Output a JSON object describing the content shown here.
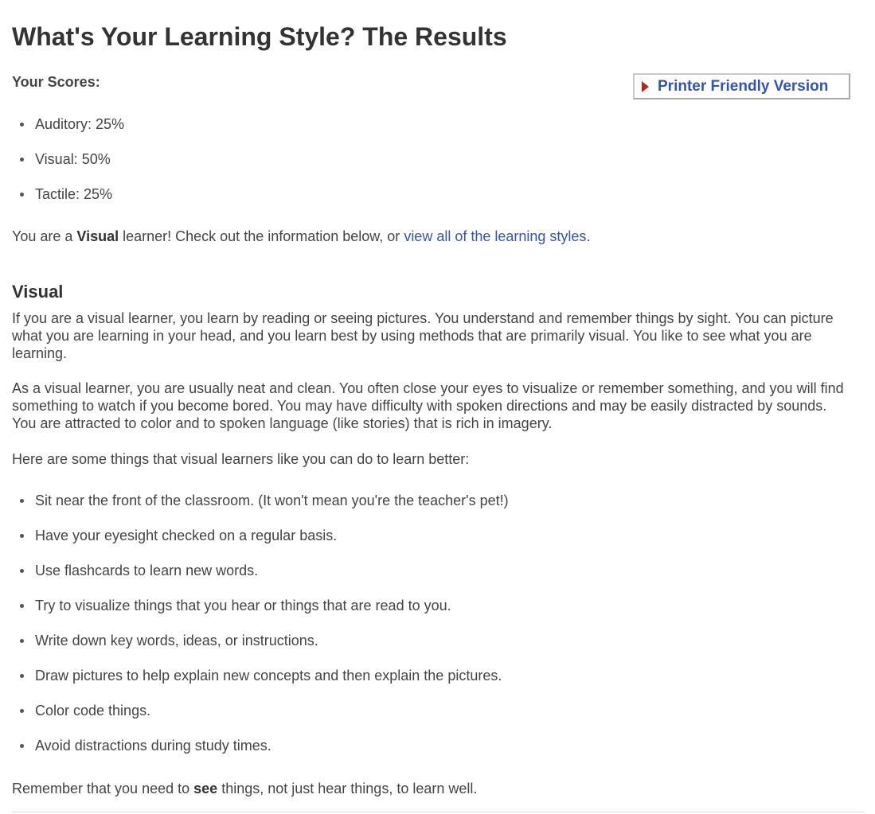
{
  "page": {
    "title": "What's Your Learning Style? The Results",
    "scores_label": "Your Scores:",
    "printer_button_label": "Printer Friendly Version",
    "scores": [
      "Auditory: 25%",
      "Visual: 50%",
      "Tactile: 25%"
    ],
    "result": {
      "prefix": "You are a ",
      "style": "Visual",
      "middle": " learner! Check out the information below, or ",
      "link_text": "view all of the learning styles",
      "suffix": "."
    }
  },
  "section": {
    "heading": "Visual",
    "paragraph1": "If you are a visual learner, you learn by reading or seeing pictures. You understand and remember things by sight. You can picture what you are learning in your head, and you learn best by using methods that are primarily visual. You like to see what you are learning.",
    "paragraph2": "As a visual learner, you are usually neat and clean. You often close your eyes to visualize or remember something, and you will find something to watch if you become bored. You may have difficulty with spoken directions and may be easily distracted by sounds. You are attracted to color and to spoken language (like stories) that is rich in imagery.",
    "tips_intro": "Here are some things that visual learners like you can do to learn better:",
    "tips": [
      "Sit near the front of the classroom. (It won't mean you're the teacher's pet!)",
      "Have your eyesight checked on a regular basis.",
      "Use flashcards to learn new words.",
      "Try to visualize things that you hear or things that are read to you.",
      "Write down key words, ideas, or instructions.",
      "Draw pictures to help explain new concepts and then explain the pictures.",
      "Color code things.",
      "Avoid distractions during study times."
    ],
    "closing": {
      "prefix": "Remember that you need to ",
      "emphasis": "see",
      "suffix": " things, not just hear things, to learn well."
    }
  },
  "colors": {
    "link": "#3354b4",
    "arrow": "#b02a1c",
    "text": "#444444",
    "heading": "#333333"
  },
  "icons": {
    "printer_button": "play-arrow-icon"
  }
}
